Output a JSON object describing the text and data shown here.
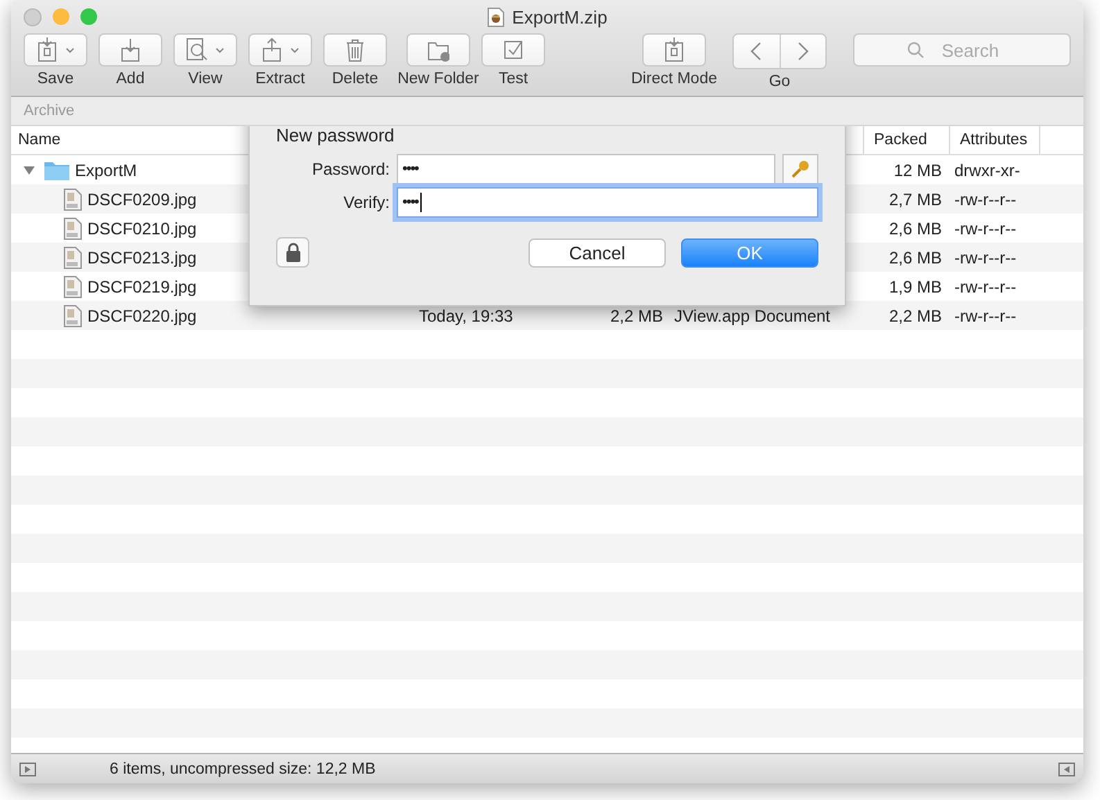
{
  "window": {
    "title": "ExportM.zip"
  },
  "toolbar": [
    {
      "label": "Save",
      "kind": "menu"
    },
    {
      "label": "Add",
      "kind": "plain"
    },
    {
      "label": "View",
      "kind": "menu"
    },
    {
      "label": "Extract",
      "kind": "menu"
    },
    {
      "label": "Delete",
      "kind": "plain"
    },
    {
      "label": "New Folder",
      "kind": "plain"
    },
    {
      "label": "Test",
      "kind": "plain"
    },
    {
      "label": "Direct Mode",
      "kind": "plain"
    },
    {
      "label": "Go",
      "kind": "segmented"
    }
  ],
  "search": {
    "placeholder": "Search"
  },
  "path_bar": "Archive",
  "table": {
    "columns": {
      "name": "Name",
      "packed": "Packed",
      "attributes": "Attributes"
    },
    "rows": [
      {
        "name": "ExportM",
        "kind": "folder",
        "expanded": true,
        "packed": "12 MB",
        "attributes": "drwxr-xr-",
        "children": [
          {
            "name": "DSCF0209.jpg",
            "kind": "file",
            "packed": "2,7 MB",
            "attributes": "-rw-r--r--"
          },
          {
            "name": "DSCF0210.jpg",
            "kind": "file",
            "packed": "2,6 MB",
            "attributes": "-rw-r--r--"
          },
          {
            "name": "DSCF0213.jpg",
            "kind": "file",
            "packed": "2,6 MB",
            "attributes": "-rw-r--r--"
          },
          {
            "name": "DSCF0219.jpg",
            "kind": "file",
            "packed": "1,9 MB",
            "attributes": "-rw-r--r--"
          },
          {
            "name": "DSCF0220.jpg",
            "kind": "file",
            "modified": "Today, 19:33",
            "size": "2,2 MB",
            "document_type": "JView.app Document",
            "packed": "2,2 MB",
            "attributes": "-rw-r--r--"
          }
        ]
      }
    ]
  },
  "status_bar": {
    "text": "6 items, uncompressed size: 12,2 MB"
  },
  "dialog": {
    "title": "New password",
    "fields": [
      {
        "label": "Password:",
        "value": "••••",
        "kind": "with-key",
        "focused": false
      },
      {
        "label": "Verify:",
        "value": "••••",
        "kind": "plain",
        "focused": true
      }
    ],
    "buttons": [
      {
        "label": "Cancel",
        "default": false
      },
      {
        "label": "OK",
        "default": true
      }
    ]
  }
}
